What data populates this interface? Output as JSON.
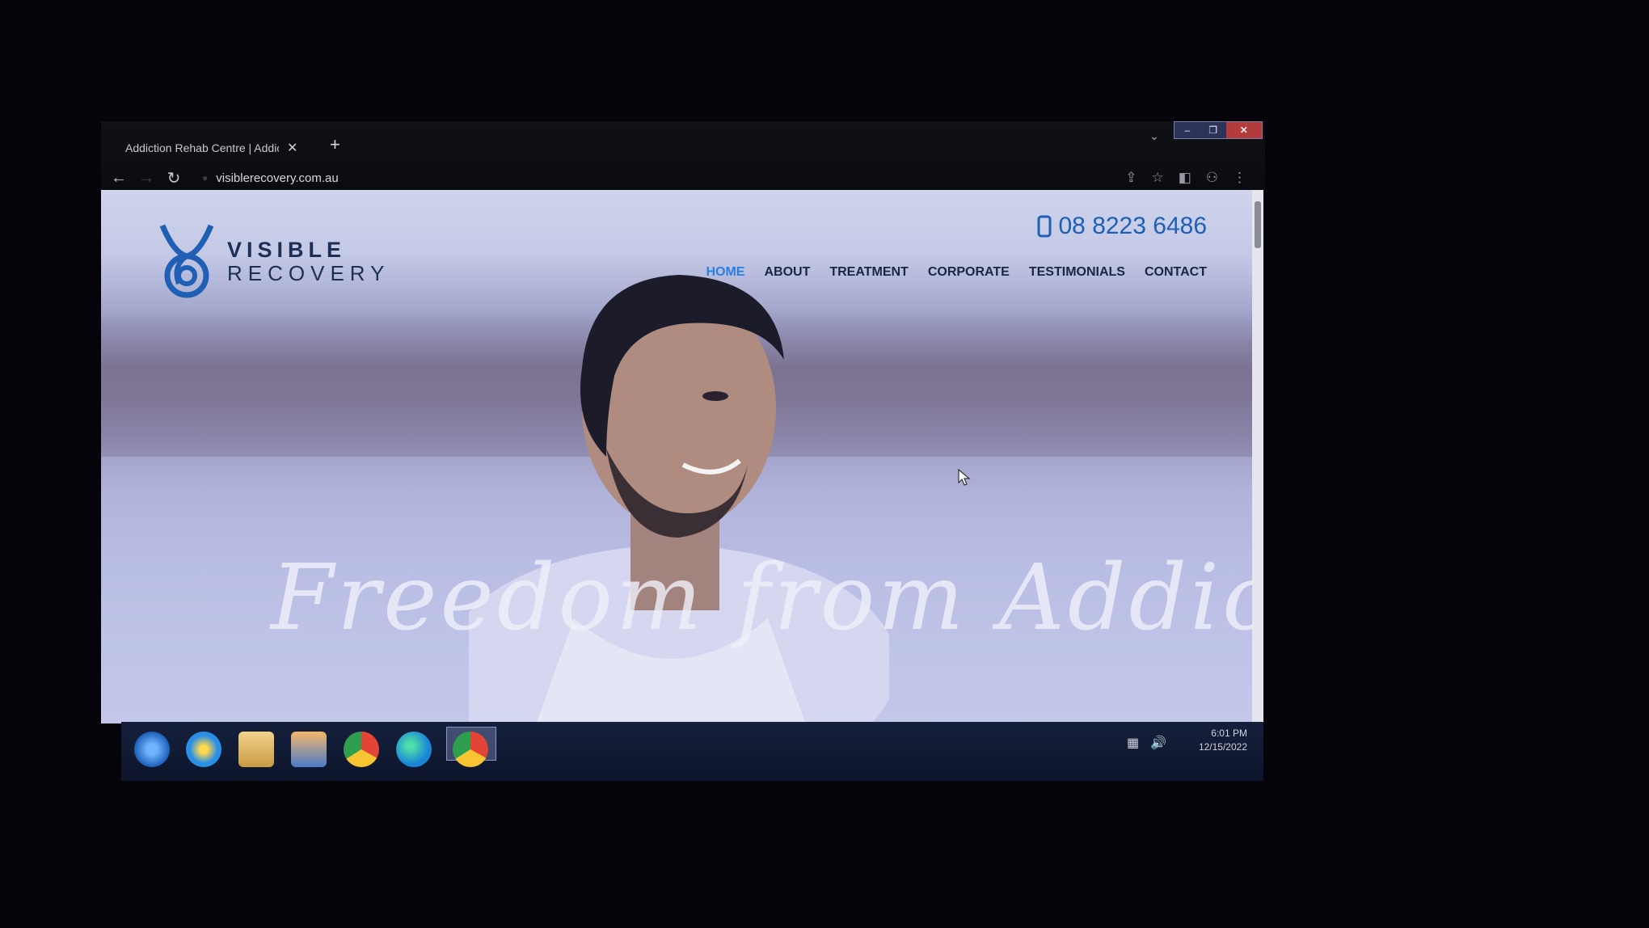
{
  "browser": {
    "tab_title": "Addiction Rehab Centre | Addic",
    "tab_close": "✕",
    "new_tab": "+",
    "url": "visiblerecovery.com.au",
    "window_controls": [
      "–",
      "❐",
      "✕"
    ]
  },
  "site": {
    "logo_line1": "VISIBLE",
    "logo_line2": "RECOVERY",
    "phone": "08 8223 6486",
    "nav": [
      "HOME",
      "ABOUT",
      "TREATMENT",
      "CORPORATE",
      "TESTIMONIALS",
      "CONTACT"
    ],
    "active_nav": "HOME",
    "headline": "Freedom from Addiction",
    "colors": {
      "brand_blue": "#1f5fb4",
      "dark_navy": "#1e2f56",
      "active_nav": "#2a80e0"
    }
  },
  "taskbar": {
    "apps": [
      "windows-start-icon",
      "internet-explorer-icon",
      "file-explorer-icon",
      "media-player-icon",
      "chrome-icon",
      "edge-icon",
      "chrome-active-icon"
    ],
    "time": "6:01 PM",
    "date": "12/15/2022"
  }
}
